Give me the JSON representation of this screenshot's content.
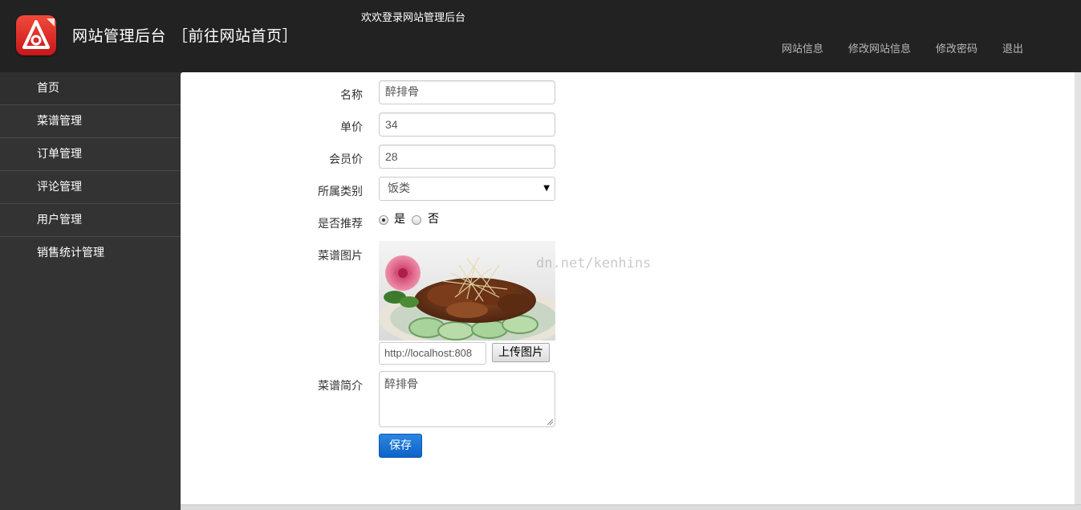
{
  "header": {
    "title": "网站管理后台",
    "home_link": "［前往网站首页］",
    "welcome": "欢欢登录网站管理后台",
    "nav": [
      "网站信息",
      "修改网站信息",
      "修改密码",
      "退出"
    ]
  },
  "sidebar": {
    "items": [
      "首页",
      "菜谱管理",
      "订单管理",
      "评论管理",
      "用户管理",
      "销售统计管理"
    ]
  },
  "form": {
    "name_label": "名称",
    "name_value": "醉排骨",
    "price_label": "单价",
    "price_value": "34",
    "member_price_label": "会员价",
    "member_price_value": "28",
    "category_label": "所属类别",
    "category_value": "饭类",
    "recommend_label": "是否推荐",
    "recommend_yes": "是",
    "recommend_no": "否",
    "recommend_selected": "是",
    "image_label": "菜谱图片",
    "image_url": "http://localhost:808",
    "upload_label": "上传图片",
    "intro_label": "菜谱简介",
    "intro_value": "醉排骨",
    "save_label": "保存"
  },
  "watermark": "dn.net/kenhins",
  "colors": {
    "header_bg": "#222222",
    "sidebar_bg": "#333333",
    "primary_button": "#1469cf"
  }
}
